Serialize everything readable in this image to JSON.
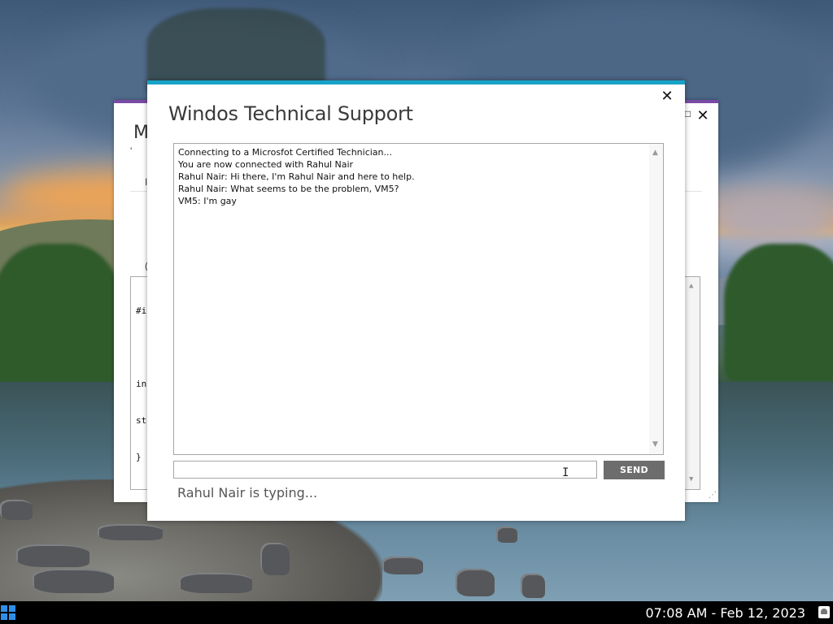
{
  "background_window": {
    "title_fragment": "M",
    "small_texts": [
      "'",
      "I",
      "("
    ],
    "code_lines": [
      "#ir",
      "",
      "int",
      "std",
      "}"
    ],
    "restore_glyph": "□",
    "close_glyph": "✕",
    "resize_grip_glyph": "⋰"
  },
  "chat": {
    "title": "Windos Technical Support",
    "close_glyph": "✕",
    "messages": [
      "Connecting to a Microsfot Certified Technician...",
      "You are now connected with Rahul Nair",
      "Rahul Nair: Hi there, I'm Rahul Nair and here to help.",
      "Rahul Nair: What seems to be the problem, VM5?",
      "VM5: I'm gay"
    ],
    "input_value": "",
    "input_placeholder": "",
    "send_label": "SEND",
    "typing_status": "Rahul Nair is typing...",
    "scroll_up_glyph": "▲",
    "scroll_down_glyph": "▼",
    "cursor_glyph": "I"
  },
  "taskbar": {
    "clock": "07:08 AM - Feb 12, 2023",
    "start_icon": "windows-logo-icon",
    "notification_icon": "notification-icon"
  },
  "colors": {
    "chat_accent": "#17a2c7",
    "background_window_accent": "#7b4aa6",
    "send_button": "#6d6d6d",
    "taskbar": "#000000",
    "start_icon": "#2f8fe8"
  }
}
